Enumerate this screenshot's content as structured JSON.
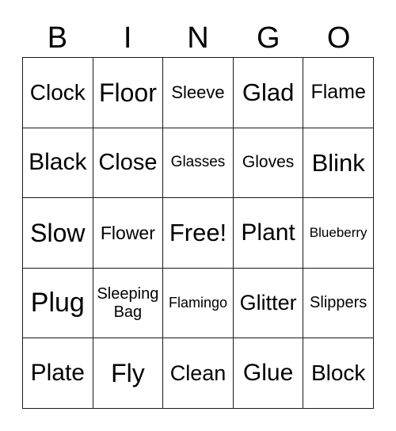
{
  "card": {
    "headers": [
      "B",
      "I",
      "N",
      "G",
      "O"
    ],
    "rows": [
      [
        {
          "text": "Clock",
          "size": 28
        },
        {
          "text": "Floor",
          "size": 32
        },
        {
          "text": "Sleeve",
          "size": 22
        },
        {
          "text": "Glad",
          "size": 31
        },
        {
          "text": "Flame",
          "size": 25
        }
      ],
      [
        {
          "text": "Black",
          "size": 30
        },
        {
          "text": "Close",
          "size": 29
        },
        {
          "text": "Glasses",
          "size": 19
        },
        {
          "text": "Gloves",
          "size": 21
        },
        {
          "text": "Blink",
          "size": 31
        }
      ],
      [
        {
          "text": "Slow",
          "size": 32
        },
        {
          "text": "Flower",
          "size": 23
        },
        {
          "text": "Free!",
          "size": 31
        },
        {
          "text": "Plant",
          "size": 30
        },
        {
          "text": "Blueberry",
          "size": 17
        }
      ],
      [
        {
          "text": "Plug",
          "size": 34
        },
        {
          "text": "Sleeping Bag",
          "size": 20
        },
        {
          "text": "Flamingo",
          "size": 18
        },
        {
          "text": "Glitter",
          "size": 27
        },
        {
          "text": "Slippers",
          "size": 20
        }
      ],
      [
        {
          "text": "Plate",
          "size": 30
        },
        {
          "text": "Fly",
          "size": 32
        },
        {
          "text": "Clean",
          "size": 27
        },
        {
          "text": "Glue",
          "size": 30
        },
        {
          "text": "Block",
          "size": 28
        }
      ]
    ],
    "free_space_text": "Free!",
    "colors": {
      "background": "#ffffff",
      "text": "#000000",
      "grid_line": "#1a1a1a"
    }
  }
}
